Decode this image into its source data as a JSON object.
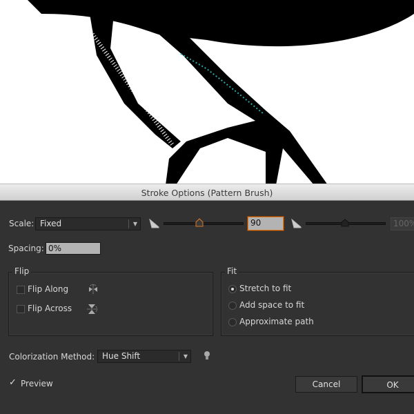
{
  "dialog": {
    "title": "Stroke Options (Pattern Brush)"
  },
  "scale": {
    "label": "Scale:",
    "value": "Fixed",
    "min_input": "90",
    "max_input": "100%",
    "min_slider_percent": 45,
    "max_slider_percent": 50
  },
  "spacing": {
    "label": "Spacing:",
    "value": "0%"
  },
  "flip": {
    "title": "Flip",
    "along": {
      "label": "Flip Along",
      "checked": false
    },
    "across": {
      "label": "Flip Across",
      "checked": false
    }
  },
  "fit": {
    "title": "Fit",
    "options": [
      {
        "label": "Stretch to fit",
        "selected": true
      },
      {
        "label": "Add space to fit",
        "selected": false
      },
      {
        "label": "Approximate path",
        "selected": false
      }
    ]
  },
  "colorization": {
    "label": "Colorization Method:",
    "value": "Hue Shift"
  },
  "preview": {
    "label": "Preview",
    "checked": true
  },
  "buttons": {
    "cancel": "Cancel",
    "ok": "OK"
  },
  "colors": {
    "accent": "#e07a20",
    "dialog_bg": "#323232",
    "path_highlight": "#2aa9a9"
  }
}
